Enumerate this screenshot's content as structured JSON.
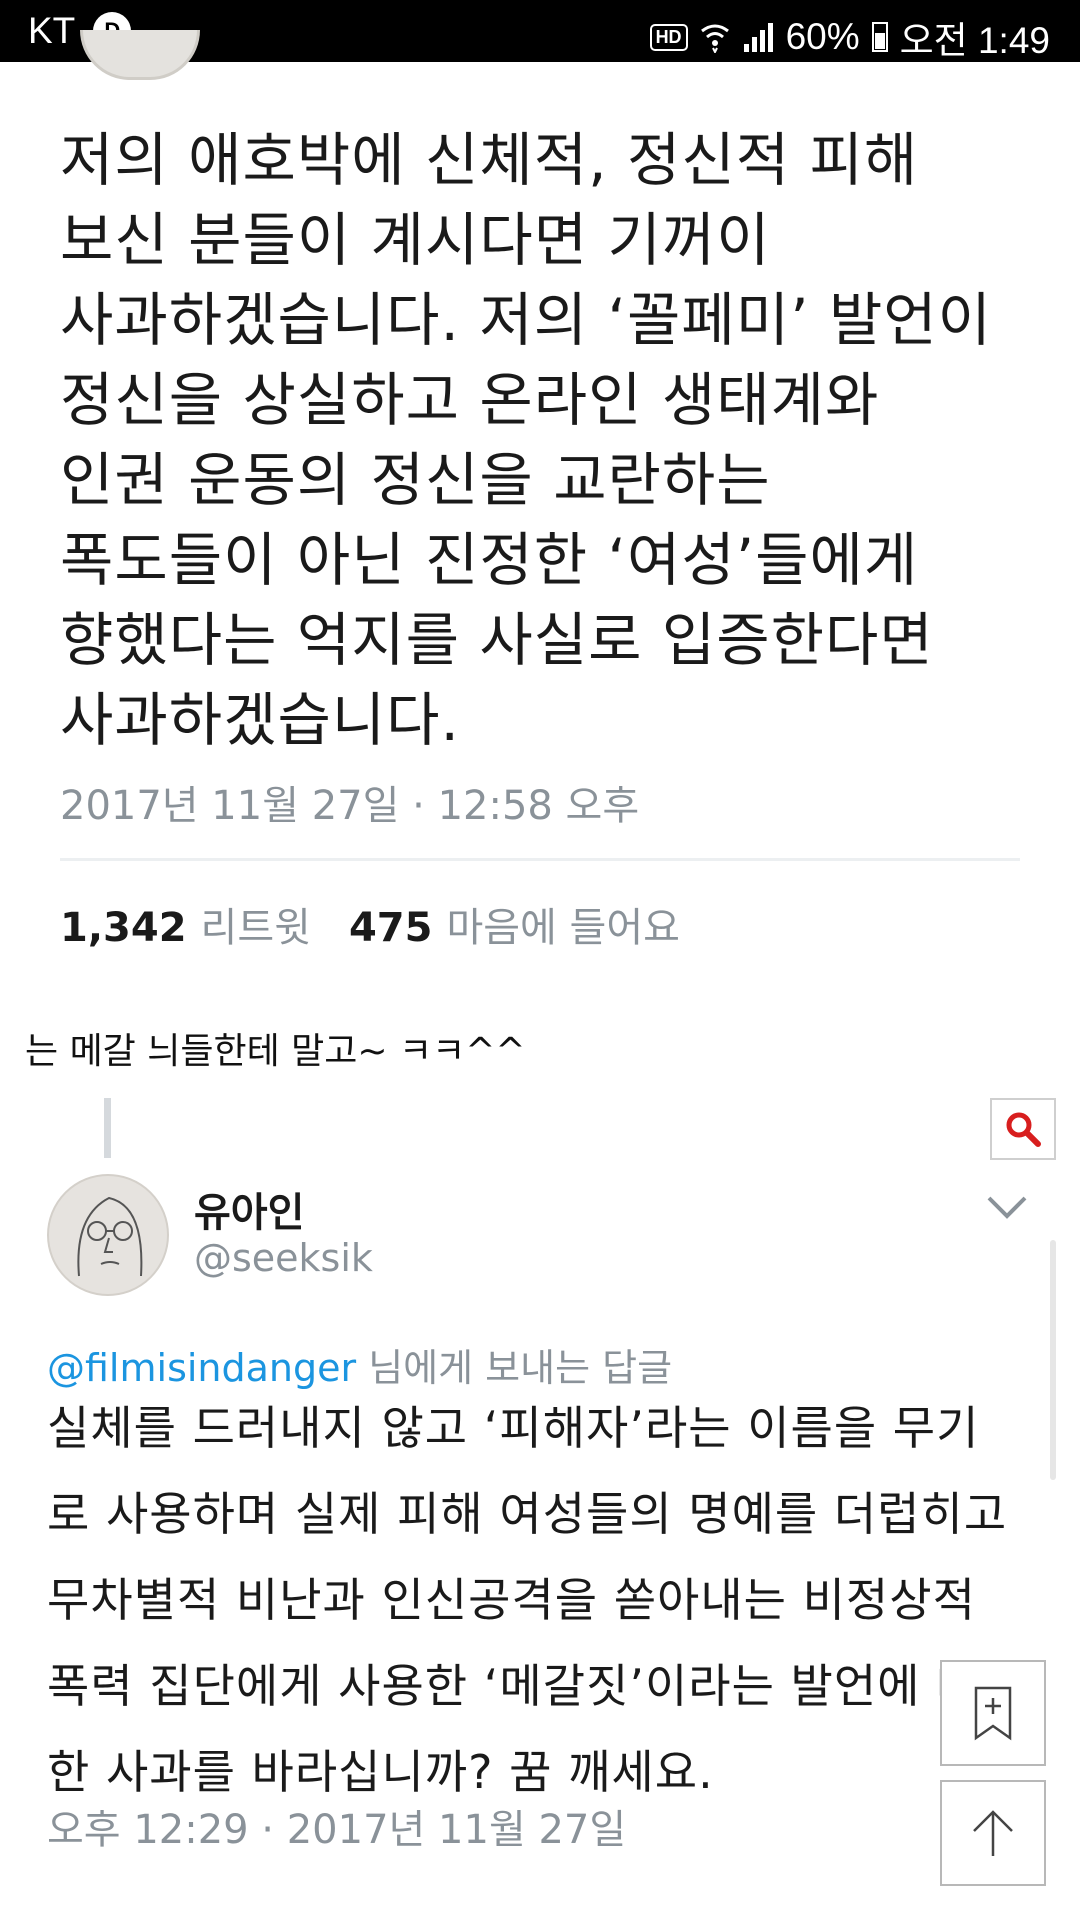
{
  "status_bar": {
    "carrier": "KT",
    "badge": "D",
    "hd": "HD",
    "battery": "60%",
    "time": "오전 1:49"
  },
  "tweet1": {
    "body": "저의 애호박에 신체적, 정신적 피해\n보신 분들이 계시다면 기꺼이\n사과하겠습니다. 저의 ‘꼴페미’ 발언이\n정신을 상실하고 온라인 생태계와\n인권 운동의 정신을  교란하는\n폭도들이 아닌 진정한 ‘여성’들에게\n향했다는 억지를 사실로 입증한다면\n사과하겠습니다.",
    "date": "2017년 11월 27일 · 12:58 오후",
    "retweets_count": "1,342",
    "retweets_label": "리트윗",
    "likes_count": "475",
    "likes_label": "마음에 들어요"
  },
  "caption": "는 메갈 늬들한테 말고~ ㅋㅋ^^",
  "tweet2": {
    "author_name": "유아인",
    "author_handle": "@seeksik",
    "reply_to_handle": "@filmisindanger",
    "reply_to_suffix": " 님에게 보내는 답글",
    "body": "실체를 드러내지 않고 ‘피해자’라는 이름을 무기\n로 사용하며 실제 피해 여성들의 명예를 더럽히고\n무차별적 비난과 인신공격을 쏟아내는 비정상적\n폭력 집단에게 사용한 ‘메갈짓’이라는 발언에 대\n한 사과를 바라십니까? 꿈 깨세요.",
    "date": "오후 12:29 · 2017년 11월 27일"
  },
  "icons": {
    "search": "search-icon",
    "bookmark": "bookmark-add-icon",
    "scroll_top": "arrow-up-icon",
    "chevron": "chevron-down-icon"
  },
  "colors": {
    "link": "#1b95e0",
    "muted": "#8a9299",
    "search_red": "#d81e1e"
  }
}
